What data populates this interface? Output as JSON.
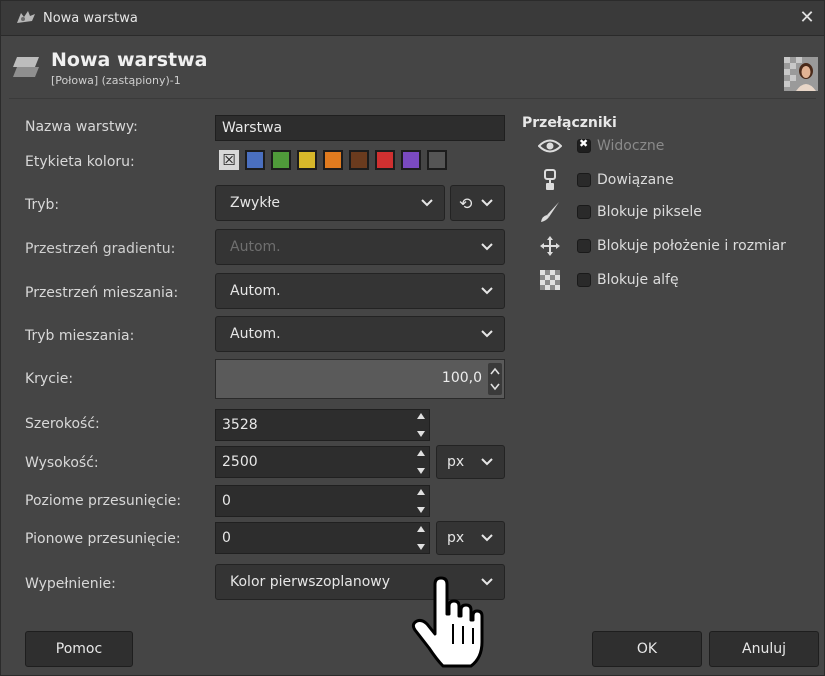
{
  "window": {
    "title": "Nowa warstwa",
    "close_glyph": "✕"
  },
  "header": {
    "title": "Nowa warstwa",
    "subtitle": "[Połowa] (zastąpiony)-1"
  },
  "form": {
    "layer_name": {
      "label": "Nazwa warstwy:",
      "value": "Warstwa"
    },
    "color_tag": {
      "label": "Etykieta koloru:",
      "none_glyph": "☒",
      "colors": [
        "#4a6fbf",
        "#4f9a3a",
        "#d6b72a",
        "#e07b1f",
        "#6a3b1e",
        "#d03030",
        "#7a4ac0",
        "#555555"
      ]
    },
    "mode": {
      "label": "Tryb:",
      "value": "Zwykłe",
      "reset_glyph": "⟲"
    },
    "blend_space": {
      "label": "Przestrzeń gradientu:",
      "value": "Autom."
    },
    "composite_space": {
      "label": "Przestrzeń mieszania:",
      "value": "Autom."
    },
    "composite_mode": {
      "label": "Tryb mieszania:",
      "value": "Autom."
    },
    "opacity": {
      "label": "Krycie:",
      "value": "100,0",
      "fraction": 1.0
    },
    "width": {
      "label": "Szerokość:",
      "value": "3528"
    },
    "height": {
      "label": "Wysokość:",
      "value": "2500",
      "unit": "px"
    },
    "offset_x": {
      "label": "Poziome przesunięcie:",
      "value": "0"
    },
    "offset_y": {
      "label": "Pionowe przesunięcie:",
      "value": "0",
      "unit": "px"
    },
    "fill": {
      "label": "Wypełnienie:",
      "value": "Kolor pierwszoplanowy"
    }
  },
  "switches": {
    "title": "Przełączniki",
    "items": [
      {
        "label": "Widoczne",
        "checked": true,
        "icon": "eye-icon"
      },
      {
        "label": "Dowiązane",
        "checked": false,
        "icon": "chain-icon"
      },
      {
        "label": "Blokuje piksele",
        "checked": false,
        "icon": "brush-icon"
      },
      {
        "label": "Blokuje położenie i rozmiar",
        "checked": false,
        "icon": "move-icon"
      },
      {
        "label": "Blokuje alfę",
        "checked": false,
        "icon": "checkerboard-icon"
      }
    ]
  },
  "buttons": {
    "help": "Pomoc",
    "ok": "OK",
    "cancel": "Anuluj"
  }
}
